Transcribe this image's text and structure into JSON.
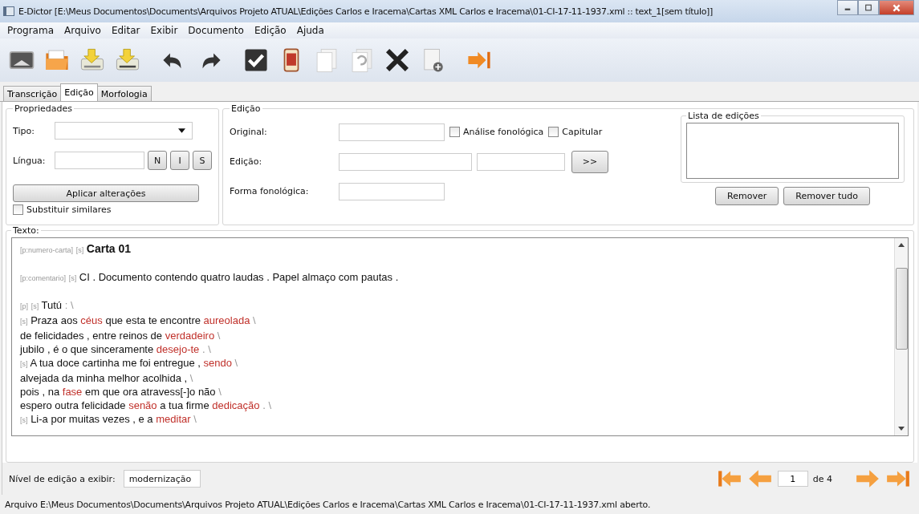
{
  "window": {
    "title": "E-Dictor [E:\\Meus Documentos\\Documents\\Arquivos Projeto ATUAL\\Edições Carlos e Iracema\\Cartas XML Carlos e Iracema\\01-CI-17-11-1937.xml :: text_1[sem título]]"
  },
  "menu": [
    "Programa",
    "Arquivo",
    "Editar",
    "Exibir",
    "Documento",
    "Edição",
    "Ajuda"
  ],
  "tabs": [
    {
      "label": "Transcrição",
      "selected": false
    },
    {
      "label": "Edição",
      "selected": true
    },
    {
      "label": "Morfologia",
      "selected": false
    }
  ],
  "propriedades": {
    "title": "Propriedades",
    "tipo_label": "Tipo:",
    "lingua_label": "Língua:",
    "lang_buttons": [
      "N",
      "I",
      "S"
    ],
    "apply_button": "Aplicar alterações",
    "substituir": {
      "label": "Substituir similares",
      "checked": false
    }
  },
  "edicao": {
    "title": "Edição",
    "original_label": "Original:",
    "analise": {
      "label": "Análise fonológica",
      "checked": false
    },
    "capitular": {
      "label": "Capitular",
      "checked": false
    },
    "edicao_label": "Edição:",
    "arrow_button": ">>",
    "forma_label": "Forma fonológica:"
  },
  "lista": {
    "title": "Lista de edições",
    "buttons": [
      "Remover",
      "Remover tudo"
    ]
  },
  "texto": {
    "title": "Texto:",
    "paragraphs": [
      [
        [
          {
            "kind": "tag",
            "text": "[p:numero-carta]"
          },
          {
            "kind": "tag",
            "text": "[s]"
          },
          {
            "kind": "title",
            "text": "Carta 01"
          }
        ]
      ],
      [
        [
          {
            "kind": "tag",
            "text": "[p:comentario]"
          },
          {
            "kind": "tag",
            "text": "[s]"
          },
          {
            "kind": "word",
            "text": "CI . Documento contendo quatro laudas . Papel almaço com pautas ."
          }
        ]
      ],
      [
        [
          {
            "kind": "tag",
            "text": "[p]"
          },
          {
            "kind": "tag",
            "text": "[s]"
          },
          {
            "kind": "word",
            "text": "Tutú"
          },
          {
            "kind": "sep",
            "text": ": \\"
          }
        ],
        [
          {
            "kind": "tag",
            "text": "[s]"
          },
          {
            "kind": "word",
            "text": "Praza aos"
          },
          {
            "kind": "edit",
            "text": "céus"
          },
          {
            "kind": "word",
            "text": "que esta te encontre"
          },
          {
            "kind": "edit",
            "text": "aureolada"
          },
          {
            "kind": "sep",
            "text": "\\"
          }
        ],
        [
          {
            "kind": "word",
            "text": "de felicidades , entre reinos de"
          },
          {
            "kind": "edit",
            "text": "verdadeiro"
          },
          {
            "kind": "sep",
            "text": "\\"
          }
        ],
        [
          {
            "kind": "word",
            "text": "jubilo , é o que sinceramente"
          },
          {
            "kind": "edit",
            "text": "desejo-te"
          },
          {
            "kind": "sep",
            "text": ". \\"
          }
        ],
        [
          {
            "kind": "tag",
            "text": "[s]"
          },
          {
            "kind": "word",
            "text": "A tua doce cartinha me foi entregue ,"
          },
          {
            "kind": "edit",
            "text": "sendo"
          },
          {
            "kind": "sep",
            "text": "\\"
          }
        ],
        [
          {
            "kind": "word",
            "text": "alvejada da minha melhor acolhida ,"
          },
          {
            "kind": "sep",
            "text": "\\"
          }
        ],
        [
          {
            "kind": "word",
            "text": "pois , na"
          },
          {
            "kind": "edit",
            "text": "fase"
          },
          {
            "kind": "word",
            "text": "em que ora atravess[-]o não"
          },
          {
            "kind": "sep",
            "text": "\\"
          }
        ],
        [
          {
            "kind": "word",
            "text": "espero outra felicidade"
          },
          {
            "kind": "edit",
            "text": "senão"
          },
          {
            "kind": "word",
            "text": "a tua firme"
          },
          {
            "kind": "edit",
            "text": "dedicação"
          },
          {
            "kind": "sep",
            "text": ". \\"
          }
        ],
        [
          {
            "kind": "tag",
            "text": "[s]"
          },
          {
            "kind": "word",
            "text": "Li-a por muitas vezes , e a"
          },
          {
            "kind": "edit",
            "text": "meditar"
          },
          {
            "kind": "sep",
            "text": "\\"
          }
        ]
      ]
    ]
  },
  "bottom": {
    "nivel_label": "Nível de edição a exibir:",
    "nivel_value": "modernização",
    "page": "1",
    "page_total": "de 4"
  },
  "status_bar": "Arquivo E:\\Meus Documentos\\Documents\\Arquivos Projeto ATUAL\\Edições Carlos e Iracema\\Cartas XML Carlos e Iracema\\01-CI-17-11-1937.xml aberto."
}
